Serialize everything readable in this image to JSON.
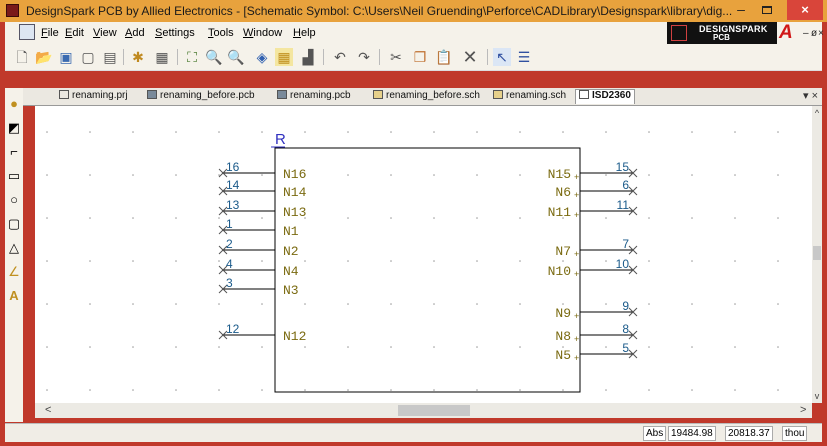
{
  "window": {
    "title": "DesignSpark PCB by Allied Electronics - [Schematic Symbol: C:\\Users\\Neil Gruending\\Perforce\\CADLibrary\\Designspark\\library\\dig...",
    "minimize_glyph": "–",
    "close_glyph": "×"
  },
  "menu": {
    "items": [
      {
        "prefix": "",
        "accel": "F",
        "rest": "ile"
      },
      {
        "prefix": "",
        "accel": "E",
        "rest": "dit"
      },
      {
        "prefix": "",
        "accel": "V",
        "rest": "iew"
      },
      {
        "prefix": "",
        "accel": "A",
        "rest": "dd"
      },
      {
        "prefix": "",
        "accel": "S",
        "rest": "ettings"
      },
      {
        "prefix": "",
        "accel": "T",
        "rest": "ools"
      },
      {
        "prefix": "",
        "accel": "W",
        "rest": "indow"
      },
      {
        "prefix": "",
        "accel": "H",
        "rest": "elp"
      }
    ],
    "mdi_min": "–",
    "mdi_restore": "ø",
    "mdi_close": "×"
  },
  "brand": {
    "line1": "DESIGNSPARK",
    "line2": "PCB",
    "logo_letter": "A",
    "accent": "#d01818"
  },
  "toolbar": {
    "icons": [
      "new-file-icon",
      "open-folder-icon",
      "save-icon",
      "close-file-icon",
      "print-icon",
      "wizard-icon",
      "grid-icon",
      "zoom-fit-icon",
      "zoom-in-icon",
      "zoom-out-icon",
      "fill-icon",
      "grid-toggle-icon",
      "chart-icon",
      "undo-icon",
      "redo-icon",
      "cut-icon",
      "copy-icon",
      "paste-icon",
      "delete-icon",
      "select-icon",
      "properties-icon"
    ]
  },
  "tabs": [
    {
      "label": "renaming.prj",
      "icon": "project-icon"
    },
    {
      "label": "renaming_before.pcb",
      "icon": "pcb-icon"
    },
    {
      "label": "renaming.pcb",
      "icon": "pcb-icon"
    },
    {
      "label": "renaming_before.sch",
      "icon": "schematic-icon"
    },
    {
      "label": "renaming.sch",
      "icon": "schematic-icon"
    },
    {
      "label": "ISD2360",
      "icon": "symbol-icon",
      "active": true
    }
  ],
  "tab_controls": {
    "pin": "▾",
    "close": "×"
  },
  "schematic": {
    "ref_label": "R",
    "left_pins": [
      {
        "name": "N16",
        "num": "16"
      },
      {
        "name": "N14",
        "num": "14"
      },
      {
        "name": "N13",
        "num": "13"
      },
      {
        "name": "N1",
        "num": "1"
      },
      {
        "name": "N2",
        "num": "2"
      },
      {
        "name": "N4",
        "num": "4"
      },
      {
        "name": "N3",
        "num": "3"
      },
      {
        "name": "N12",
        "num": "12"
      }
    ],
    "right_pins": [
      {
        "name": "N15",
        "num": "15"
      },
      {
        "name": "N6",
        "num": "6"
      },
      {
        "name": "N11",
        "num": "11"
      },
      {
        "name": "N7",
        "num": "7"
      },
      {
        "name": "N10",
        "num": "10"
      },
      {
        "name": "N9",
        "num": "9"
      },
      {
        "name": "N8",
        "num": "8"
      },
      {
        "name": "N5",
        "num": "5"
      }
    ],
    "colors": {
      "body": "#000000",
      "pin_name": "#7a6a10",
      "pin_num": "#1a5a8a",
      "pin_line": "#000000",
      "ref": "#3030c0"
    }
  },
  "scroll": {
    "left": "<",
    "right": ">",
    "up": "^",
    "down": "v"
  },
  "status": {
    "mode": "Abs",
    "x": "19484.98",
    "y": "20818.37",
    "units": "thou"
  }
}
